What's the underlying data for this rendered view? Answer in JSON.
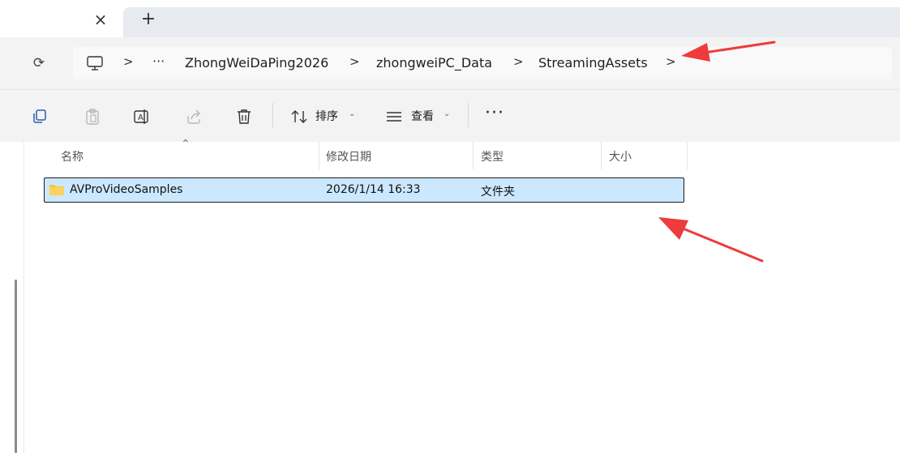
{
  "tabs": {
    "close_glyph": "×",
    "new_glyph": "+"
  },
  "nav": {
    "refresh_glyph": "⟳",
    "separator": ">",
    "overflow": "···",
    "breadcrumbs": [
      "ZhongWeiDaPing2026",
      "zhongweiPC_Data",
      "StreamingAssets"
    ]
  },
  "toolbar": {
    "sort_label": "排序",
    "view_label": "查看",
    "more_label": "···",
    "icons": [
      "copy-icon",
      "paste-icon",
      "rename-icon",
      "share-icon",
      "delete-icon",
      "sort-icon",
      "view-icon"
    ]
  },
  "columns": {
    "name": "名称",
    "modified": "修改日期",
    "type": "类型",
    "size": "大小"
  },
  "files": [
    {
      "name": "AVProVideoSamples",
      "modified": "2026/1/14 16:33",
      "type": "文件夹",
      "size": ""
    }
  ],
  "colors": {
    "selection": "#cce8ff",
    "annotation_arrow": "#ee3b3b",
    "folder": "#f4c542"
  }
}
